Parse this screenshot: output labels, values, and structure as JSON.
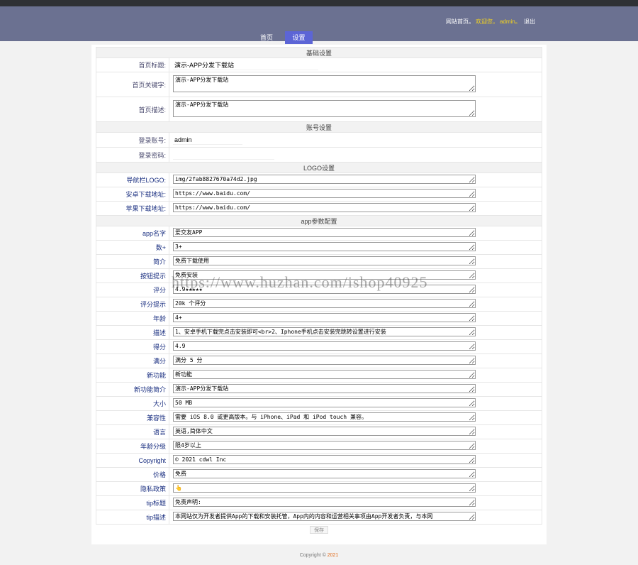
{
  "header": {
    "site_home": "网站首页。",
    "welcome": "欢迎您，",
    "username": "admin。",
    "logout": "退出"
  },
  "nav": {
    "home": "首页",
    "settings": "设置"
  },
  "sections": {
    "basic": "基础设置",
    "account": "账号设置",
    "logo": "LOGO设置",
    "app": "app参数配置"
  },
  "basic": {
    "title_label": "首页标题:",
    "title_value": "演示-APP分发下载站",
    "keywords_label": "首页关键字:",
    "keywords_value": "演示-APP分发下载站",
    "desc_label": "首页描述:",
    "desc_value": "演示-APP分发下载站"
  },
  "account": {
    "user_label": "登录账号:",
    "user_value": "admin",
    "pass_label": "登录密码:",
    "pass_value": ""
  },
  "logo": {
    "logo_label": "导航栏LOGO:",
    "logo_value": "img/2fab8827670a74d2.jpg",
    "android_label": "安卓下载地址:",
    "android_value": "https://www.baidu.com/",
    "ios_label": "苹果下载地址:",
    "ios_value": "https://www.baidu.com/"
  },
  "app": [
    {
      "label": "app名字",
      "value": "爱交友APP"
    },
    {
      "label": "数+",
      "value": "3+"
    },
    {
      "label": "简介",
      "value": "免费下载使用"
    },
    {
      "label": "按钮提示",
      "value": "免费安装"
    },
    {
      "label": "评分",
      "value": "4.9★★★★★"
    },
    {
      "label": "评分提示",
      "value": "20k 个评分"
    },
    {
      "label": "年龄",
      "value": "4+"
    },
    {
      "label": "描述",
      "value": "1、安卓手机下载完点击安装即可<br>2、Iphone手机点击安装完跳转设置进行安装"
    },
    {
      "label": "得分",
      "value": "4.9"
    },
    {
      "label": "满分",
      "value": "满分 5 分"
    },
    {
      "label": "新功能",
      "value": "新功能"
    },
    {
      "label": "新功能简介",
      "value": "演示-APP分发下载站"
    },
    {
      "label": "大小",
      "value": "50 MB"
    },
    {
      "label": "兼容性",
      "value": "需要 iOS 8.0 或更高版本。与 iPhone、iPad 和 iPod touch 兼容。"
    },
    {
      "label": "语言",
      "value": "英语,简体中文"
    },
    {
      "label": "年龄分级",
      "value": "限4岁以上"
    },
    {
      "label": "Copyright",
      "value": "© 2021 cdwl Inc"
    },
    {
      "label": "价格",
      "value": "免费"
    },
    {
      "label": "隐私政策",
      "value": "👆"
    },
    {
      "label": "tip标题",
      "value": "免责声明:"
    },
    {
      "label": "tip描述",
      "value": "本网站仅为开发者提供App的下载和安装托管，App内的内容和运营相关事项由App开发者负责，与本网"
    }
  ],
  "save_label": "保存",
  "footer": {
    "text": "Copyright © ",
    "year": "2021"
  },
  "watermark": "https://www.huzhan.com/ishop40925"
}
